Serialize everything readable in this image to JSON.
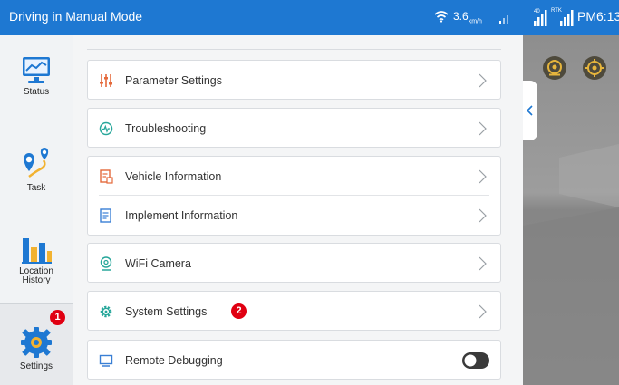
{
  "statusbar": {
    "title": "Driving in Manual Mode",
    "speed_value": "3.6",
    "speed_unit": "km/h",
    "sig2_label": "40",
    "sig3_label": "RTK",
    "time": "PM6:13"
  },
  "sidebar": {
    "items": [
      {
        "label": "Status"
      },
      {
        "label": "Task"
      },
      {
        "label": "Location History",
        "line1": "Location",
        "line2": "History"
      },
      {
        "label": "Settings",
        "badge": "1"
      }
    ]
  },
  "menu": {
    "parameter_settings": "Parameter Settings",
    "troubleshooting": "Troubleshooting",
    "vehicle_information": "Vehicle Information",
    "implement_information": "Implement Information",
    "wifi_camera": "WiFi Camera",
    "system_settings": "System Settings",
    "system_settings_badge": "2",
    "remote_debugging": "Remote Debugging",
    "remote_debugging_enabled": false
  },
  "colors": {
    "accent": "#1e78d2",
    "badge": "#e00012",
    "icon_orange": "#e4693b",
    "icon_teal": "#28a79b",
    "icon_blue": "#3a7fd5"
  }
}
